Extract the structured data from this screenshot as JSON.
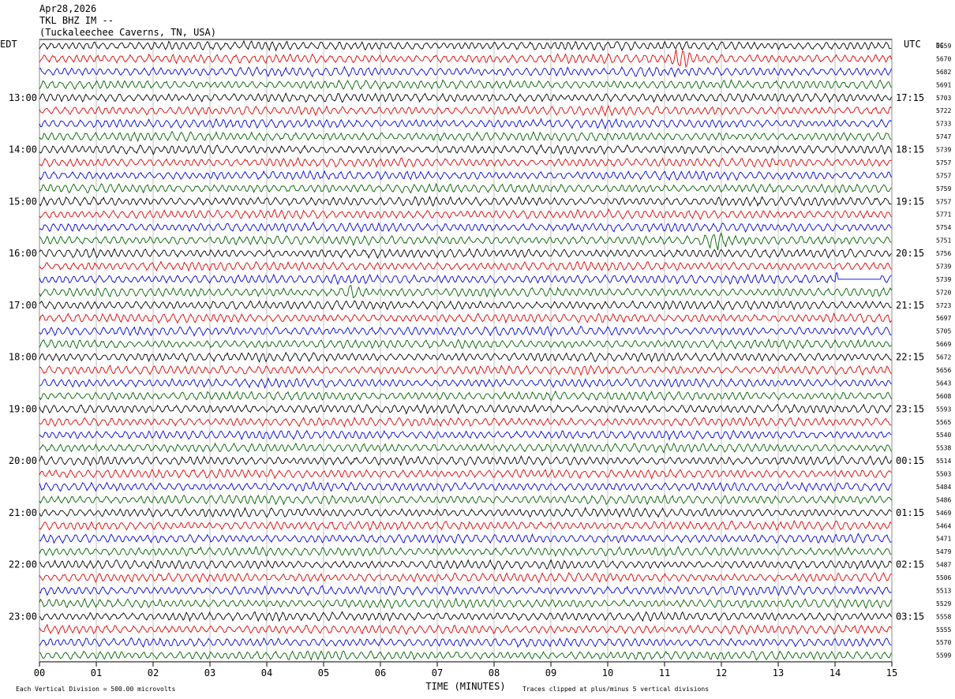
{
  "header": {
    "date": "Apr28,2026",
    "station": "TKL BHZ IM --",
    "location": "(Tuckaleechee Caverns, TN, USA)"
  },
  "chart_data": {
    "type": "line",
    "title": "TKL BHZ IM --",
    "left_axis_label": "EDT",
    "right_axis_label": "UTC",
    "dc_label": "DC",
    "xlabel": "TIME (MINUTES)",
    "x_ticks": [
      "00",
      "01",
      "02",
      "03",
      "04",
      "05",
      "06",
      "07",
      "08",
      "09",
      "10",
      "11",
      "12",
      "13",
      "14",
      "15"
    ],
    "xlim": [
      0,
      15
    ],
    "left_time_labels": [
      "13:00",
      "14:00",
      "15:00",
      "16:00",
      "17:00",
      "18:00",
      "19:00",
      "20:00",
      "21:00",
      "22:00",
      "23:00"
    ],
    "right_time_labels": [
      "17:15",
      "18:15",
      "19:15",
      "20:15",
      "21:15",
      "22:15",
      "23:15",
      "00:15",
      "01:15",
      "02:15",
      "03:15"
    ],
    "hour_label_start_trace": 4,
    "traces_per_hour": 4,
    "trace_colors": [
      "#000000",
      "#e00000",
      "#0000e0",
      "#006000"
    ],
    "dc_values": [
      5659,
      5670,
      5682,
      5691,
      5703,
      5722,
      5733,
      5747,
      5739,
      5757,
      5757,
      5759,
      5757,
      5771,
      5754,
      5751,
      5756,
      5739,
      5739,
      5720,
      5723,
      5697,
      5705,
      5669,
      5672,
      5656,
      5643,
      5608,
      5593,
      5565,
      5540,
      5538,
      5514,
      5503,
      5484,
      5486,
      5469,
      5464,
      5471,
      5479,
      5487,
      5506,
      5513,
      5529,
      5558,
      5555,
      5570,
      5599
    ],
    "events": [
      {
        "trace": 1,
        "minute": 11.3,
        "note": "burst"
      },
      {
        "trace": 15,
        "minute": 11.9,
        "note": "burst"
      },
      {
        "trace": 19,
        "minute": 5.5,
        "note": "burst"
      }
    ],
    "data_gap": {
      "trace": 18,
      "start_minute": 14.0,
      "end_minute": 14.8
    },
    "footer_left": "Each Vertical Division =  500.00 microvolts",
    "footer_right": "Traces clipped at plus/minus 5 vertical divisions"
  }
}
